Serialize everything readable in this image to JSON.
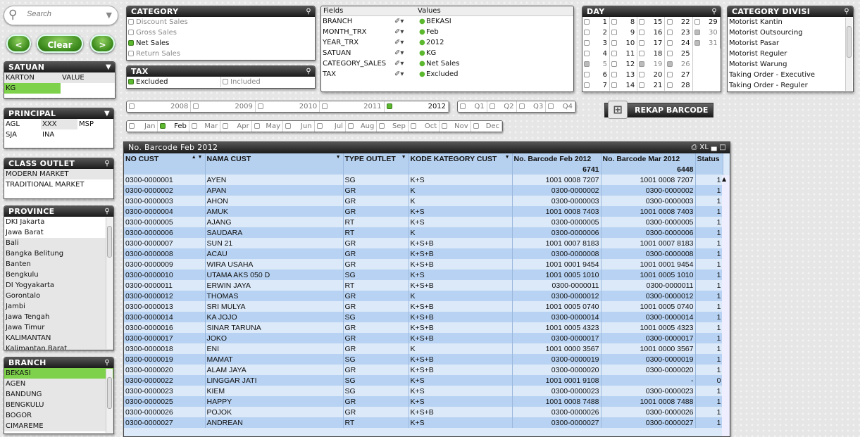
{
  "search": {
    "placeholder": "Search"
  },
  "nav": {
    "back": "<",
    "clear": "Clear",
    "forward": ">"
  },
  "satuan": {
    "title": "SATUAN",
    "items": [
      "KARTON",
      "VALUE",
      "KG"
    ],
    "selected": "KG"
  },
  "principal": {
    "title": "PRINCIPAL",
    "items": [
      "AGL",
      "XXX",
      "MSP",
      "SJA",
      "INA"
    ]
  },
  "class_outlet": {
    "title": "CLASS OUTLET",
    "items": [
      "MODERN MARKET",
      "TRADITIONAL MARKET"
    ]
  },
  "province": {
    "title": "PROVINCE",
    "items": [
      "DKI Jakarta",
      "Jawa Barat",
      "Bali",
      "Bangka Belitung",
      "Banten",
      "Bengkulu",
      "DI Yogyakarta",
      "Gorontalo",
      "Jambi",
      "Jawa Tengah",
      "Jawa Timur",
      "KALIMANTAN",
      "Kalimantan Barat"
    ]
  },
  "branch": {
    "title": "BRANCH",
    "items": [
      "BEKASI",
      "AGEN",
      "BANDUNG",
      "BENGKULU",
      "BOGOR",
      "CIMAREME"
    ],
    "selected": "BEKASI"
  },
  "category": {
    "title": "CATEGORY",
    "items": [
      "Discount Sales",
      "Gross Sales",
      "Net Sales",
      "Return Sales"
    ],
    "selected": "Net Sales"
  },
  "tax": {
    "title": "TAX",
    "items": [
      "Excluded",
      "Included"
    ],
    "selected": "Excluded"
  },
  "current_selections": {
    "fields_header": "Fields",
    "values_header": "Values",
    "rows": [
      [
        "BRANCH",
        "BEKASI"
      ],
      [
        "MONTH_TRX",
        "Feb"
      ],
      [
        "YEAR_TRX",
        "2012"
      ],
      [
        "SATUAN",
        "KG"
      ],
      [
        "CATEGORY_SALES",
        "Net Sales"
      ],
      [
        "TAX",
        "Excluded"
      ]
    ]
  },
  "day": {
    "title": "DAY",
    "excluded": [
      5,
      19,
      26,
      30,
      31
    ]
  },
  "category_divisi": {
    "title": "CATEGORY DIVISI",
    "items": [
      "Motorist Kantin",
      "Motorist Outsourcing",
      "Motorist Pasar",
      "Motorist Reguler",
      "Motorist Warung",
      "Taking Order - Executive",
      "Taking Order - Reguler"
    ]
  },
  "years": {
    "items": [
      "2008",
      "2009",
      "2010",
      "2011",
      "2012"
    ],
    "selected": "2012"
  },
  "quarters": {
    "items": [
      "Q1",
      "Q2",
      "Q3",
      "Q4"
    ]
  },
  "months": {
    "items": [
      "Jan",
      "Feb",
      "Mar",
      "Apr",
      "May",
      "Jun",
      "Jul",
      "Aug",
      "Sep",
      "Oct",
      "Nov",
      "Dec"
    ],
    "selected": "Feb"
  },
  "rekap_button": "REKAP BARCODE",
  "table": {
    "title": "No. Barcode Feb 2012",
    "toolbar": "XL",
    "columns": [
      "NO CUST",
      "NAMA CUST",
      "TYPE OUTLET",
      "KODE KATEGORY CUST",
      "No. Barcode Feb 2012",
      "No. Barcode Mar 2012",
      "Status"
    ],
    "totals": [
      "",
      "",
      "",
      "",
      "6741",
      "6448",
      ""
    ],
    "rows": [
      [
        "0300-0000001",
        "AYEN",
        "SG",
        "K+S",
        "1001 0008 7207",
        "1001 0008 7207",
        "1"
      ],
      [
        "0300-0000002",
        "APAN",
        "GR",
        "K",
        "0300-0000002",
        "0300-0000002",
        "1"
      ],
      [
        "0300-0000003",
        "AHON",
        "GR",
        "K",
        "0300-0000003",
        "0300-0000003",
        "1"
      ],
      [
        "0300-0000004",
        "AMUK",
        "GR",
        "K+S",
        "1001 0008 7403",
        "1001 0008 7403",
        "1"
      ],
      [
        "0300-0000005",
        "AJANG",
        "RT",
        "K+S",
        "0300-0000005",
        "0300-0000005",
        "1"
      ],
      [
        "0300-0000006",
        "SAUDARA",
        "RT",
        "K",
        "0300-0000006",
        "0300-0000006",
        "1"
      ],
      [
        "0300-0000007",
        "SUN 21",
        "GR",
        "K+S+B",
        "1001 0007 8183",
        "1001 0007 8183",
        "1"
      ],
      [
        "0300-0000008",
        "ACAU",
        "GR",
        "K+S+B",
        "0300-0000008",
        "0300-0000008",
        "1"
      ],
      [
        "0300-0000009",
        "WIRA USAHA",
        "GR",
        "K+S+B",
        "1001 0001 9454",
        "1001 0001 9454",
        "1"
      ],
      [
        "0300-0000010",
        "UTAMA AKS 050 D",
        "SG",
        "K+S",
        "1001 0005 1010",
        "1001 0005 1010",
        "1"
      ],
      [
        "0300-0000011",
        "ERWIN JAYA",
        "RT",
        "K+S+B",
        "0300-0000011",
        "0300-0000011",
        "1"
      ],
      [
        "0300-0000012",
        "THOMAS",
        "GR",
        "K",
        "0300-0000012",
        "0300-0000012",
        "1"
      ],
      [
        "0300-0000013",
        "SRI MULYA",
        "GR",
        "K+S+B",
        "1001 0005 0740",
        "1001 0005 0740",
        "1"
      ],
      [
        "0300-0000014",
        "KA JOJO",
        "SG",
        "K+S+B",
        "0300-0000014",
        "0300-0000014",
        "1"
      ],
      [
        "0300-0000016",
        "SINAR TARUNA",
        "GR",
        "K+S+B",
        "1001 0005 4323",
        "1001 0005 4323",
        "1"
      ],
      [
        "0300-0000017",
        "JOKO",
        "GR",
        "K+S+B",
        "0300-0000017",
        "0300-0000017",
        "1"
      ],
      [
        "0300-0000018",
        "ENI",
        "GR",
        "K",
        "1001 0000 3567",
        "1001 0000 3567",
        "1"
      ],
      [
        "0300-0000019",
        "MAMAT",
        "SG",
        "K+S+B",
        "0300-0000019",
        "0300-0000019",
        "1"
      ],
      [
        "0300-0000020",
        "ALAM JAYA",
        "GR",
        "K+S+B",
        "0300-0000020",
        "0300-0000020",
        "1"
      ],
      [
        "0300-0000022",
        "LINGGAR JATI",
        "SG",
        "K+S",
        "1001 0001 9108",
        "-",
        "0"
      ],
      [
        "0300-0000023",
        "KIEM",
        "SG",
        "K+S",
        "0300-0000023",
        "0300-0000023",
        "1"
      ],
      [
        "0300-0000025",
        "HAPPY",
        "GR",
        "K+S",
        "1001 0008 7488",
        "1001 0008 7488",
        "1"
      ],
      [
        "0300-0000026",
        "POJOK",
        "GR",
        "K+S+B",
        "0300-0000026",
        "0300-0000026",
        "1"
      ],
      [
        "0300-0000027",
        "ANDREAN",
        "RT",
        "K+S",
        "0300-0000027",
        "0300-0000027",
        "1"
      ]
    ]
  }
}
